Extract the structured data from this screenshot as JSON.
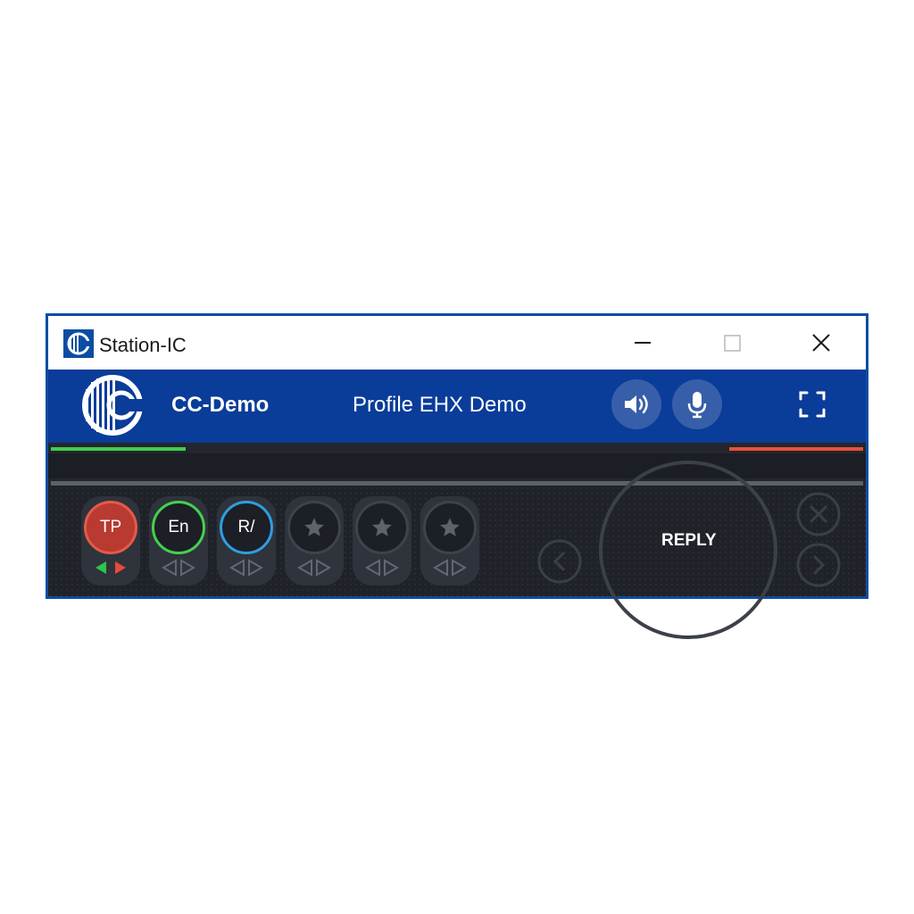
{
  "window": {
    "title": "Station-IC"
  },
  "window_controls": {
    "minimize": "minimize-icon",
    "maximize": "maximize-icon",
    "close": "close-icon"
  },
  "header": {
    "device_name": "CC-Demo",
    "profile_name": "Profile EHX Demo",
    "speaker_icon": "speaker-icon",
    "mic_icon": "microphone-icon",
    "fullscreen_icon": "fullscreen-icon"
  },
  "keys": [
    {
      "label": "TP",
      "state": "active",
      "ring_color": "#e45a4a",
      "fill_color": "#b83a30",
      "talk_color": "#2fc44a",
      "listen_color": "#e84a3a"
    },
    {
      "label": "En",
      "state": "assigned",
      "ring_color": "#44d14e"
    },
    {
      "label": "R/",
      "state": "assigned",
      "ring_color": "#2f9de0"
    },
    {
      "label": "",
      "state": "empty",
      "icon": "star-icon"
    },
    {
      "label": "",
      "state": "empty",
      "icon": "star-icon"
    },
    {
      "label": "",
      "state": "empty",
      "icon": "star-icon"
    }
  ],
  "reply": {
    "label": "REPLY"
  },
  "nav": {
    "prev_icon": "chevron-left-icon",
    "clear_icon": "close-icon",
    "next_icon": "chevron-right-icon"
  },
  "colors": {
    "titlebar_bg": "#ffffff",
    "header_bg": "#0a3c99",
    "window_border": "#0a4da2",
    "panel_bg": "#202229",
    "level_input": "#3fcf4f",
    "level_output": "#e8503d"
  }
}
